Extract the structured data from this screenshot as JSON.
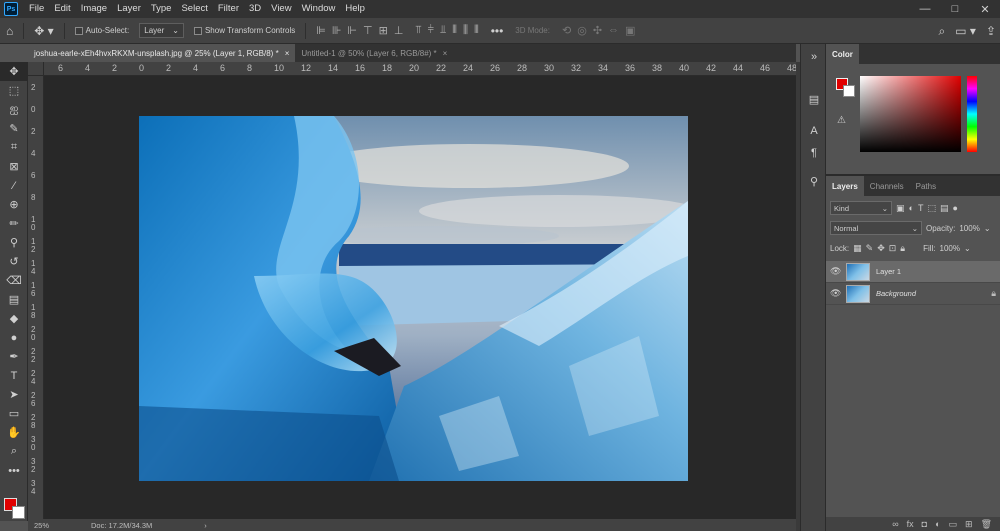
{
  "menu": {
    "items": [
      "File",
      "Edit",
      "Image",
      "Layer",
      "Type",
      "Select",
      "Filter",
      "3D",
      "View",
      "Window",
      "Help"
    ],
    "window_controls": [
      "—",
      "□",
      "✕"
    ]
  },
  "options_bar": {
    "auto_select_label": "Auto-Select:",
    "auto_select_target": "Layer",
    "show_transform_label": "Show Transform Controls",
    "mode_3d_label": "3D Mode:"
  },
  "tabs": [
    {
      "label": "joshua-earle-xEh4hvxRKXM-unsplash.jpg @ 25% (Layer 1, RGB/8) *",
      "close": "×"
    },
    {
      "label": "Untitled-1 @ 50% (Layer 6, RGB/8#) *",
      "close": "×"
    }
  ],
  "ruler_h": [
    "6",
    "4",
    "2",
    "0",
    "2",
    "4",
    "6",
    "8",
    "10",
    "12",
    "14",
    "16",
    "18",
    "20",
    "22",
    "24",
    "26",
    "28",
    "30",
    "32",
    "34",
    "36",
    "38",
    "40",
    "42",
    "44",
    "46",
    "48"
  ],
  "ruler_v": [
    "2",
    "0",
    "2",
    "4",
    "6",
    "8",
    "1\n0",
    "1\n2",
    "1\n4",
    "1\n6",
    "1\n8",
    "2\n0",
    "2\n2",
    "2\n4",
    "2\n6",
    "2\n8",
    "3\n0",
    "3\n2",
    "3\n4"
  ],
  "status": {
    "zoom": "25%",
    "doc": "Doc: 17.2M/34.3M",
    "arrow": "›"
  },
  "color_panel": {
    "tab": "Color",
    "foreground": "#e00000",
    "background": "#ffffff"
  },
  "layers_panel": {
    "tabs": [
      "Layers",
      "Channels",
      "Paths"
    ],
    "filter_kind": "Kind",
    "blend_mode": "Normal",
    "opacity_label": "Opacity:",
    "opacity_value": "100%",
    "lock_label": "Lock:",
    "fill_label": "Fill:",
    "fill_value": "100%",
    "layers": [
      {
        "name": "Layer 1",
        "selected": true,
        "locked": false
      },
      {
        "name": "Background",
        "selected": false,
        "locked": true
      }
    ]
  }
}
